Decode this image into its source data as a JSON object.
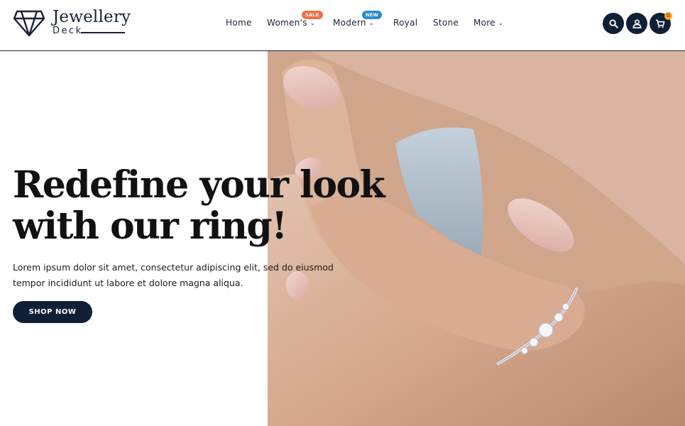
{
  "brand": {
    "name": "Jewellery",
    "sub": "Deck"
  },
  "nav": {
    "items": [
      {
        "label": "Home"
      },
      {
        "label": "Women's",
        "badge": "SALE",
        "badge_color": "#f07045"
      },
      {
        "label": "Modern",
        "badge": "NEW",
        "badge_color": "#2a8fd2"
      },
      {
        "label": "Royal"
      },
      {
        "label": "Stone"
      },
      {
        "label": "More"
      }
    ]
  },
  "header_icons": {
    "search": "search-icon",
    "account": "user-icon",
    "cart": "cart-icon",
    "cart_count": "0"
  },
  "hero": {
    "title_line1": "Redefine your look",
    "title_line2": "with our ring!",
    "description": "Lorem ipsum dolor sit amet, consectetur adipiscing elit, sed do eiusmod tempor incididunt ut labore et dolore magna aliqua.",
    "cta": "SHOP NOW"
  },
  "colors": {
    "primary": "#0f2036",
    "sale_badge": "#f07045",
    "new_badge": "#2a8fd2",
    "cart_badge": "#f5a623"
  }
}
